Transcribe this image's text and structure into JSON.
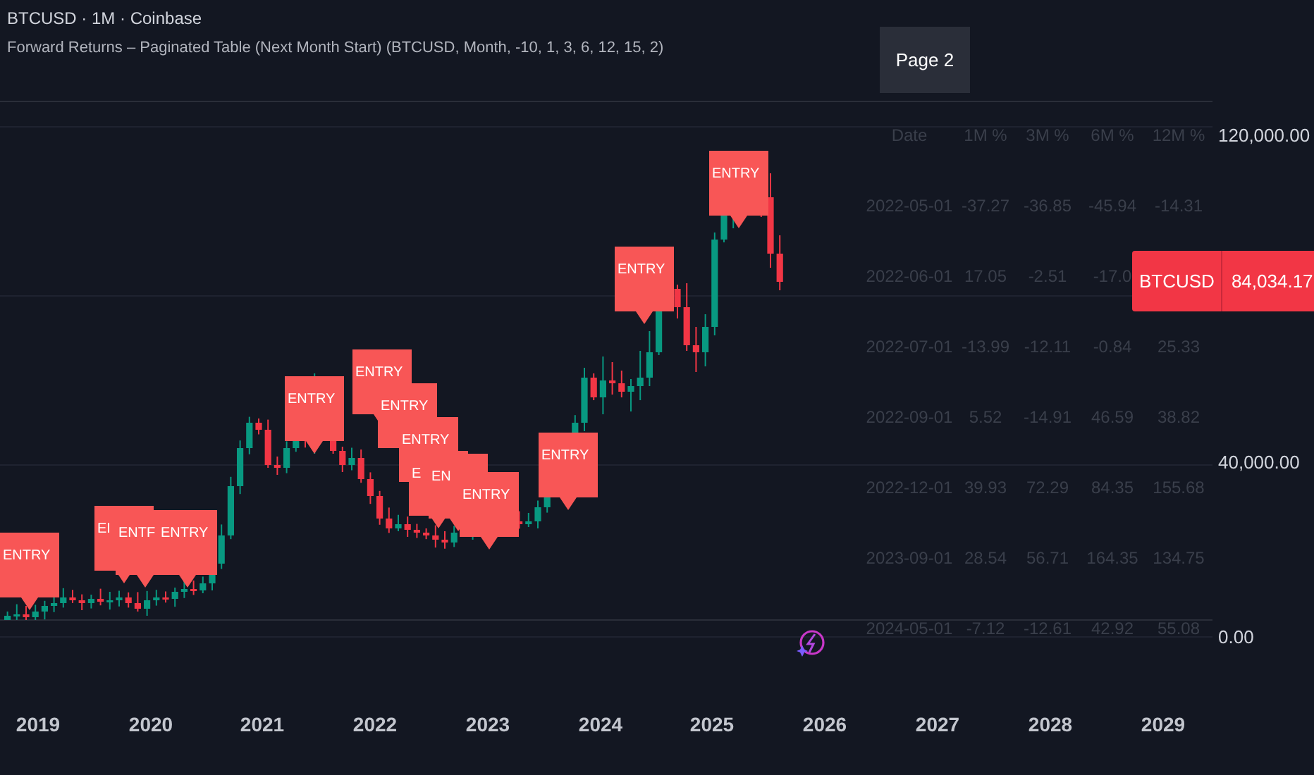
{
  "legend": {
    "symbol_line": "BTCUSD · 1M · Coinbase",
    "indicator_line": "Forward Returns – Paginated Table (Next Month Start) (BTCUSD, Month, -10, 1, 3, 6, 12, 15, 2)"
  },
  "page_button": "Page 2",
  "table": {
    "columns": [
      "Date",
      "1M %",
      "3M %",
      "6M %",
      "12M %"
    ],
    "rows": [
      [
        "2022-05-01",
        "-37.27",
        "-36.85",
        "-45.94",
        "-14.31"
      ],
      [
        "2022-06-01",
        "17.05",
        "-2.51",
        "-17.0"
      ],
      [
        "2022-07-01",
        "-13.99",
        "-12.11",
        "-0.84",
        "25.33"
      ],
      [
        "2022-09-01",
        "5.52",
        "-14.91",
        "46.59",
        "38.82"
      ],
      [
        "2022-12-01",
        "39.93",
        "72.29",
        "84.35",
        "155.68"
      ],
      [
        "2023-09-01",
        "28.54",
        "56.71",
        "164.35",
        "134.75"
      ],
      [
        "2024-05-01",
        "-7.12",
        "-12.61",
        "42.92",
        "55.08"
      ]
    ]
  },
  "entry_labels": [
    "ENTRY",
    "EI",
    "ENTF",
    "ENTRY",
    "ENTRY",
    "ENTRY",
    "ENTRY",
    "ENTRY",
    "E",
    "EN",
    "ENTRY",
    "ENTRY",
    "ENTRY",
    "ENTRY"
  ],
  "price_tag": {
    "symbol": "BTCUSD",
    "price": "84,034.17"
  },
  "price_axis": [
    "120,000.00",
    "40,000.00",
    "0.00"
  ],
  "time_axis": [
    "2019",
    "2020",
    "2021",
    "2022",
    "2023",
    "2024",
    "2025",
    "2026",
    "2027",
    "2028",
    "2029"
  ]
}
